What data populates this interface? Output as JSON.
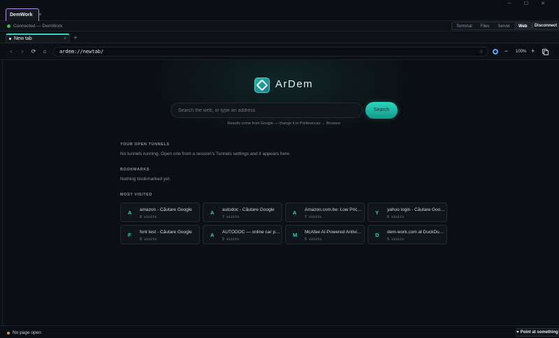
{
  "window": {
    "minimize_icon": "minimize-icon",
    "maximize_icon": "maximize-icon",
    "close_icon": "close-icon"
  },
  "workspace": {
    "tab_label": "DemWork",
    "close_glyph": "×"
  },
  "connection": {
    "status_text": "Connected — DemWork",
    "status_color": "#3fb950"
  },
  "modes": [
    {
      "label": "Terminal"
    },
    {
      "label": "Files"
    },
    {
      "label": "Server"
    },
    {
      "label": "Web",
      "active": true
    }
  ],
  "disconnect_label": "Disconnect",
  "tabs": [
    {
      "label": "New tab",
      "close_glyph": "×"
    }
  ],
  "new_tab_glyph": "+",
  "nav": {
    "back_glyph": "‹",
    "forward_glyph": "›",
    "reload_glyph": "⟳",
    "home_glyph": "⌂",
    "url": "ardem://newtab/",
    "star_glyph": "☆",
    "zoom_out_glyph": "−",
    "zoom": "100%",
    "zoom_in_glyph": "+"
  },
  "brand": {
    "name": "ArDem",
    "accent": "#2dd4bf"
  },
  "search": {
    "placeholder": "Search the web, or type an address",
    "button_label": "Search",
    "hint": "Results come from Google — change it in Preferences → Browser"
  },
  "sections": {
    "tunnels_title": "YOUR OPEN TUNNELS",
    "tunnels_text": "No tunnels running. Open one from a session's Tunnels settings and it appears here.",
    "bookmarks_title": "BOOKMARKS",
    "bookmarks_text": "Nothing bookmarked yet.",
    "most_visited_title": "MOST VISITED"
  },
  "most_visited": [
    {
      "letter": "A",
      "title": "amazon - Căutare Google",
      "visits": "8 visits"
    },
    {
      "letter": "A",
      "title": "autodoc - Căutare Google",
      "visits": "7 visits"
    },
    {
      "letter": "A",
      "title": "Amazon.com.be: Low Prices in Electronics",
      "visits": "7 visits"
    },
    {
      "letter": "Y",
      "title": "yahoo login - Căutare Google",
      "visits": "6 visits"
    },
    {
      "letter": "F",
      "title": "font test - Căutare Google",
      "visits": "6 visits"
    },
    {
      "letter": "A",
      "title": "AUTODOC — online car parts",
      "visits": "5 visits"
    },
    {
      "letter": "M",
      "title": "McAfee AI-Powered Antivirus",
      "visits": "5 visits"
    },
    {
      "letter": "D",
      "title": "dem-work.com at DuckDuckGo",
      "visits": "5 visits"
    }
  ],
  "footer": {
    "status": "No page open",
    "status_color": "#d29922",
    "point_label": "Point at something",
    "point_glyph": "⌖"
  }
}
